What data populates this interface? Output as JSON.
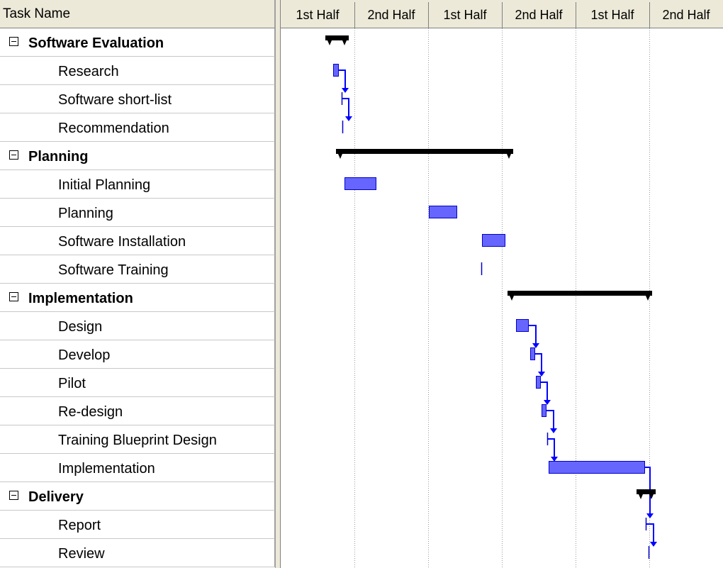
{
  "grid": {
    "column_header": "Task Name",
    "rows": [
      {
        "label": "Software Evaluation",
        "level": 0
      },
      {
        "label": "Research",
        "level": 1
      },
      {
        "label": "Software short-list",
        "level": 1
      },
      {
        "label": "Recommendation",
        "level": 1
      },
      {
        "label": "Planning",
        "level": 0
      },
      {
        "label": "Initial Planning",
        "level": 1
      },
      {
        "label": "Planning",
        "level": 1
      },
      {
        "label": "Software Installation",
        "level": 1
      },
      {
        "label": "Software Training",
        "level": 1
      },
      {
        "label": "Implementation",
        "level": 0
      },
      {
        "label": "Design",
        "level": 1
      },
      {
        "label": "Develop",
        "level": 1
      },
      {
        "label": "Pilot",
        "level": 1
      },
      {
        "label": "Re-design",
        "level": 1
      },
      {
        "label": "Training Blueprint Design",
        "level": 1
      },
      {
        "label": "Implementation",
        "level": 1
      },
      {
        "label": "Delivery",
        "level": 0
      },
      {
        "label": "Report",
        "level": 1
      },
      {
        "label": "Review",
        "level": 1
      }
    ]
  },
  "timescale": {
    "labels": [
      "1st Half",
      "2nd Half",
      "1st Half",
      "2nd Half",
      "1st Half",
      "2nd Half"
    ]
  },
  "colors": {
    "task_bar": "#6666ff",
    "task_border": "#0000cc",
    "summary_bar": "#000000",
    "link": "#0000ff",
    "header_bg": "#ece9d8"
  }
}
